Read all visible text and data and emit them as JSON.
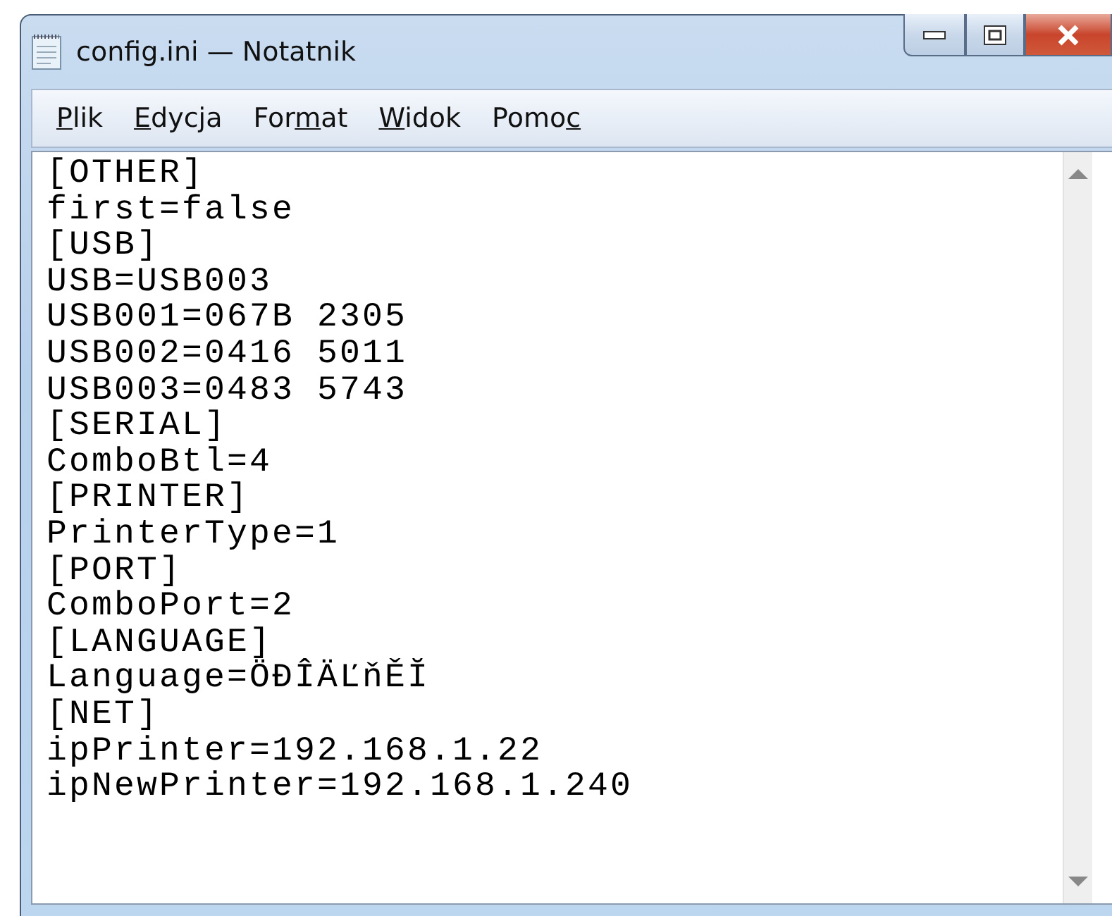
{
  "window": {
    "title": "config.ini — Notatnik"
  },
  "menu": [
    {
      "key": "P",
      "post": "lik"
    },
    {
      "key": "E",
      "post": "dycja"
    },
    {
      "pre": "For",
      "key": "m",
      "post": "at"
    },
    {
      "key": "W",
      "post": "idok"
    },
    {
      "pre": "Pomo",
      "key": "c"
    }
  ],
  "editor": {
    "lines": [
      "[OTHER]",
      "first=false",
      "[USB]",
      "USB=USB003",
      "USB001=067B 2305",
      "USB002=0416 5011",
      "USB003=0483 5743",
      "[SERIAL]",
      "ComboBtl=4",
      "[PRINTER]",
      "PrinterType=1",
      "[PORT]",
      "ComboPort=2",
      "[LANGUAGE]",
      "Language=ÖĐÎÄĽňĚĬ",
      "[NET]",
      "ipPrinter=192.168.1.22",
      "ipNewPrinter=192.168.1.240"
    ]
  }
}
